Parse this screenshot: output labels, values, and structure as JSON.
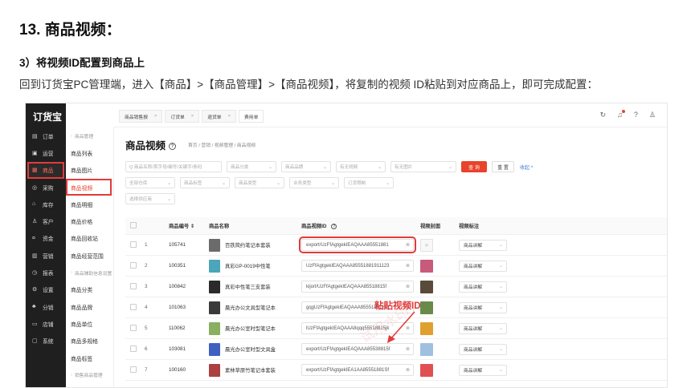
{
  "doc": {
    "heading": "13. 商品视频：",
    "subheading": "3）将视频ID配置到商品上",
    "paragraph": "回到订货宝PC管理端，进入【商品】>【商品管理】>【商品视频】，将复制的视频 ID粘贴到对应商品上，即可完成配置："
  },
  "app": {
    "logo": "订货宝",
    "sidebar": [
      {
        "icon": "order-icon",
        "glyph": "▤",
        "label": "订单"
      },
      {
        "icon": "ops-icon",
        "glyph": "▣",
        "label": "运营"
      },
      {
        "icon": "goods-icon",
        "glyph": "▦",
        "label": "商品",
        "active": true
      },
      {
        "icon": "purchase-icon",
        "glyph": "◎",
        "label": "采购"
      },
      {
        "icon": "stock-icon",
        "glyph": "⌂",
        "label": "库存"
      },
      {
        "icon": "customer-icon",
        "glyph": "♙",
        "label": "客户"
      },
      {
        "icon": "fund-icon",
        "glyph": "¤",
        "label": "资金"
      },
      {
        "icon": "marketing-icon",
        "glyph": "▥",
        "label": "营销"
      },
      {
        "icon": "report-icon",
        "glyph": "◷",
        "label": "报表"
      },
      {
        "icon": "settings-icon",
        "glyph": "⚙",
        "label": "设置"
      },
      {
        "icon": "sales-icon",
        "glyph": "♣",
        "label": "分销"
      },
      {
        "icon": "shop-icon",
        "glyph": "▭",
        "label": "店铺"
      },
      {
        "icon": "system-icon",
        "glyph": "▢",
        "label": "系统"
      }
    ],
    "subnav": [
      {
        "label": "商品管理",
        "group": true
      },
      {
        "label": "商品列表"
      },
      {
        "label": "商品图片"
      },
      {
        "label": "商品视频",
        "active": true
      },
      {
        "label": "商品明细"
      },
      {
        "label": "商品价格"
      },
      {
        "label": "商品回收站"
      },
      {
        "label": "商品经营范围"
      },
      {
        "label": "商品辅助信息设置",
        "group": true
      },
      {
        "label": "商品分类"
      },
      {
        "label": "商品品牌"
      },
      {
        "label": "商品单位"
      },
      {
        "label": "商品多规格"
      },
      {
        "label": "商品标签"
      },
      {
        "label": "销售商品管理",
        "group": true
      }
    ],
    "tabs": [
      {
        "label": "商品销售报"
      },
      {
        "label": "订货单"
      },
      {
        "label": "退货单"
      },
      {
        "label": "费用单",
        "on": true
      }
    ],
    "page_title": "商品视频",
    "breadcrumb": "首页 / 营销 / 视频管理 / 商品视频",
    "filters": {
      "keyword": "Q 商品名称/首字母/编号/关键字/条码",
      "category": "商品分类",
      "brand": "商品品牌",
      "has_video": "有无视频",
      "has_image": "有无图片",
      "warehouse": "全部仓库",
      "tag": "商品标签",
      "type": "商品类型",
      "business": "业务类型",
      "order_limit": "订货限制",
      "supplier": "选择供应商",
      "query_btn": "查 询",
      "reset_btn": "重 置",
      "collapse": "收起 ^"
    },
    "table": {
      "headers": {
        "no": "商品编号",
        "name": "商品名称",
        "video": "商品视频ID",
        "cover": "视频封面",
        "mark": "视频标注"
      },
      "rows": [
        {
          "idx": "1",
          "no": "105741",
          "name": "百铁简约笔记本套装",
          "video": "export/UzFfAgtgekIEAQAAA85551881",
          "mark": "商品讲解",
          "thumb": "#6b6b6b",
          "cover": "add"
        },
        {
          "idx": "2",
          "no": "100351",
          "name": "真彩GP-0019中性笔",
          "video": "UzFfAgtgekIEAQAAA85551881911123",
          "mark": "商品讲解",
          "thumb": "#4aa6b8",
          "cover": "#c85a7c"
        },
        {
          "idx": "3",
          "no": "100842",
          "name": "真彩中性笔三支套装",
          "video": "kijorl/UzFfAgtgekIEAQAAA85518815f",
          "mark": "商品讲解",
          "thumb": "#2a2a2a",
          "cover": "#5a4a3a"
        },
        {
          "idx": "4",
          "no": "101063",
          "name": "晨光办公文具型笔记本",
          "video": "gqgUzFfAgtgekIEAQAAA85551881Sf",
          "mark": "商品讲解",
          "thumb": "#3a3a3a",
          "cover": "#6a8a4a"
        },
        {
          "idx": "5",
          "no": "110062",
          "name": "晨光办公室时型笔记本",
          "video": "lUzFfAgtgekIEAQAAA8qqq55518815jk",
          "mark": "商品讲解",
          "thumb": "#88b060",
          "cover": "#e0a030"
        },
        {
          "idx": "6",
          "no": "103081",
          "name": "晨光办公室时型文具盒",
          "video": "export/UzFfAgtgekIEAQAAA85538815f",
          "mark": "商品讲解",
          "thumb": "#4060c0",
          "cover": "#a0c0e0"
        },
        {
          "idx": "7",
          "no": "100160",
          "name": "素林草原竹笔记本套装",
          "video": "export/UzFfAgtgekIEA1AA85551881Sf",
          "mark": "商品讲解",
          "thumb": "#aa4040",
          "cover": "#e05050"
        }
      ]
    },
    "annotation": "粘贴视频ID",
    "watermark": "试用水印"
  }
}
